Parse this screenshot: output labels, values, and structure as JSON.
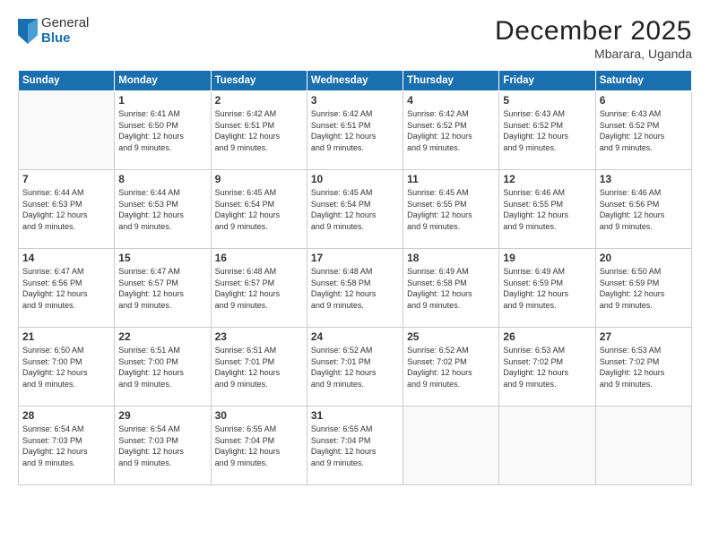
{
  "logo": {
    "general": "General",
    "blue": "Blue"
  },
  "title": "December 2025",
  "subtitle": "Mbarara, Uganda",
  "days_header": [
    "Sunday",
    "Monday",
    "Tuesday",
    "Wednesday",
    "Thursday",
    "Friday",
    "Saturday"
  ],
  "weeks": [
    [
      {
        "day": "",
        "sunrise": "",
        "sunset": "",
        "daylight1": "",
        "daylight2": ""
      },
      {
        "day": "1",
        "sunrise": "Sunrise: 6:41 AM",
        "sunset": "Sunset: 6:50 PM",
        "daylight1": "Daylight: 12 hours",
        "daylight2": "and 9 minutes."
      },
      {
        "day": "2",
        "sunrise": "Sunrise: 6:42 AM",
        "sunset": "Sunset: 6:51 PM",
        "daylight1": "Daylight: 12 hours",
        "daylight2": "and 9 minutes."
      },
      {
        "day": "3",
        "sunrise": "Sunrise: 6:42 AM",
        "sunset": "Sunset: 6:51 PM",
        "daylight1": "Daylight: 12 hours",
        "daylight2": "and 9 minutes."
      },
      {
        "day": "4",
        "sunrise": "Sunrise: 6:42 AM",
        "sunset": "Sunset: 6:52 PM",
        "daylight1": "Daylight: 12 hours",
        "daylight2": "and 9 minutes."
      },
      {
        "day": "5",
        "sunrise": "Sunrise: 6:43 AM",
        "sunset": "Sunset: 6:52 PM",
        "daylight1": "Daylight: 12 hours",
        "daylight2": "and 9 minutes."
      },
      {
        "day": "6",
        "sunrise": "Sunrise: 6:43 AM",
        "sunset": "Sunset: 6:52 PM",
        "daylight1": "Daylight: 12 hours",
        "daylight2": "and 9 minutes."
      }
    ],
    [
      {
        "day": "7",
        "sunrise": "Sunrise: 6:44 AM",
        "sunset": "Sunset: 6:53 PM",
        "daylight1": "Daylight: 12 hours",
        "daylight2": "and 9 minutes."
      },
      {
        "day": "8",
        "sunrise": "Sunrise: 6:44 AM",
        "sunset": "Sunset: 6:53 PM",
        "daylight1": "Daylight: 12 hours",
        "daylight2": "and 9 minutes."
      },
      {
        "day": "9",
        "sunrise": "Sunrise: 6:45 AM",
        "sunset": "Sunset: 6:54 PM",
        "daylight1": "Daylight: 12 hours",
        "daylight2": "and 9 minutes."
      },
      {
        "day": "10",
        "sunrise": "Sunrise: 6:45 AM",
        "sunset": "Sunset: 6:54 PM",
        "daylight1": "Daylight: 12 hours",
        "daylight2": "and 9 minutes."
      },
      {
        "day": "11",
        "sunrise": "Sunrise: 6:45 AM",
        "sunset": "Sunset: 6:55 PM",
        "daylight1": "Daylight: 12 hours",
        "daylight2": "and 9 minutes."
      },
      {
        "day": "12",
        "sunrise": "Sunrise: 6:46 AM",
        "sunset": "Sunset: 6:55 PM",
        "daylight1": "Daylight: 12 hours",
        "daylight2": "and 9 minutes."
      },
      {
        "day": "13",
        "sunrise": "Sunrise: 6:46 AM",
        "sunset": "Sunset: 6:56 PM",
        "daylight1": "Daylight: 12 hours",
        "daylight2": "and 9 minutes."
      }
    ],
    [
      {
        "day": "14",
        "sunrise": "Sunrise: 6:47 AM",
        "sunset": "Sunset: 6:56 PM",
        "daylight1": "Daylight: 12 hours",
        "daylight2": "and 9 minutes."
      },
      {
        "day": "15",
        "sunrise": "Sunrise: 6:47 AM",
        "sunset": "Sunset: 6:57 PM",
        "daylight1": "Daylight: 12 hours",
        "daylight2": "and 9 minutes."
      },
      {
        "day": "16",
        "sunrise": "Sunrise: 6:48 AM",
        "sunset": "Sunset: 6:57 PM",
        "daylight1": "Daylight: 12 hours",
        "daylight2": "and 9 minutes."
      },
      {
        "day": "17",
        "sunrise": "Sunrise: 6:48 AM",
        "sunset": "Sunset: 6:58 PM",
        "daylight1": "Daylight: 12 hours",
        "daylight2": "and 9 minutes."
      },
      {
        "day": "18",
        "sunrise": "Sunrise: 6:49 AM",
        "sunset": "Sunset: 6:58 PM",
        "daylight1": "Daylight: 12 hours",
        "daylight2": "and 9 minutes."
      },
      {
        "day": "19",
        "sunrise": "Sunrise: 6:49 AM",
        "sunset": "Sunset: 6:59 PM",
        "daylight1": "Daylight: 12 hours",
        "daylight2": "and 9 minutes."
      },
      {
        "day": "20",
        "sunrise": "Sunrise: 6:50 AM",
        "sunset": "Sunset: 6:59 PM",
        "daylight1": "Daylight: 12 hours",
        "daylight2": "and 9 minutes."
      }
    ],
    [
      {
        "day": "21",
        "sunrise": "Sunrise: 6:50 AM",
        "sunset": "Sunset: 7:00 PM",
        "daylight1": "Daylight: 12 hours",
        "daylight2": "and 9 minutes."
      },
      {
        "day": "22",
        "sunrise": "Sunrise: 6:51 AM",
        "sunset": "Sunset: 7:00 PM",
        "daylight1": "Daylight: 12 hours",
        "daylight2": "and 9 minutes."
      },
      {
        "day": "23",
        "sunrise": "Sunrise: 6:51 AM",
        "sunset": "Sunset: 7:01 PM",
        "daylight1": "Daylight: 12 hours",
        "daylight2": "and 9 minutes."
      },
      {
        "day": "24",
        "sunrise": "Sunrise: 6:52 AM",
        "sunset": "Sunset: 7:01 PM",
        "daylight1": "Daylight: 12 hours",
        "daylight2": "and 9 minutes."
      },
      {
        "day": "25",
        "sunrise": "Sunrise: 6:52 AM",
        "sunset": "Sunset: 7:02 PM",
        "daylight1": "Daylight: 12 hours",
        "daylight2": "and 9 minutes."
      },
      {
        "day": "26",
        "sunrise": "Sunrise: 6:53 AM",
        "sunset": "Sunset: 7:02 PM",
        "daylight1": "Daylight: 12 hours",
        "daylight2": "and 9 minutes."
      },
      {
        "day": "27",
        "sunrise": "Sunrise: 6:53 AM",
        "sunset": "Sunset: 7:02 PM",
        "daylight1": "Daylight: 12 hours",
        "daylight2": "and 9 minutes."
      }
    ],
    [
      {
        "day": "28",
        "sunrise": "Sunrise: 6:54 AM",
        "sunset": "Sunset: 7:03 PM",
        "daylight1": "Daylight: 12 hours",
        "daylight2": "and 9 minutes."
      },
      {
        "day": "29",
        "sunrise": "Sunrise: 6:54 AM",
        "sunset": "Sunset: 7:03 PM",
        "daylight1": "Daylight: 12 hours",
        "daylight2": "and 9 minutes."
      },
      {
        "day": "30",
        "sunrise": "Sunrise: 6:55 AM",
        "sunset": "Sunset: 7:04 PM",
        "daylight1": "Daylight: 12 hours",
        "daylight2": "and 9 minutes."
      },
      {
        "day": "31",
        "sunrise": "Sunrise: 6:55 AM",
        "sunset": "Sunset: 7:04 PM",
        "daylight1": "Daylight: 12 hours",
        "daylight2": "and 9 minutes."
      },
      {
        "day": "",
        "sunrise": "",
        "sunset": "",
        "daylight1": "",
        "daylight2": ""
      },
      {
        "day": "",
        "sunrise": "",
        "sunset": "",
        "daylight1": "",
        "daylight2": ""
      },
      {
        "day": "",
        "sunrise": "",
        "sunset": "",
        "daylight1": "",
        "daylight2": ""
      }
    ]
  ]
}
